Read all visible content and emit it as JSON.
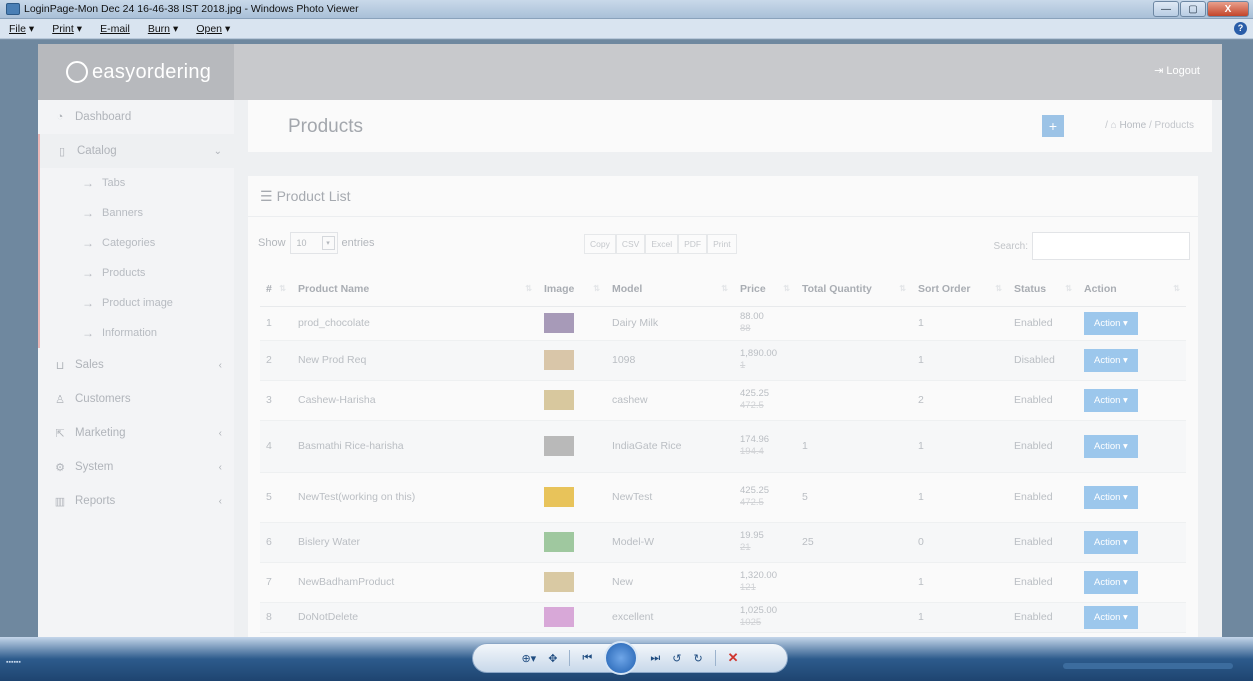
{
  "window": {
    "title": "LoginPage-Mon Dec 24 16-46-38 IST 2018.jpg - Windows Photo Viewer",
    "min": "—",
    "max": "▢",
    "close": "X"
  },
  "menu": {
    "items": [
      "File",
      "Print",
      "E-mail",
      "Burn",
      "Open"
    ],
    "help": "?"
  },
  "app": {
    "logo": "easyordering",
    "logout": "Logout",
    "sidebar": {
      "dashboard": "Dashboard",
      "catalog": "Catalog",
      "catalog_items": [
        "Tabs",
        "Banners",
        "Categories",
        "Products",
        "Product image",
        "Information"
      ],
      "sales": "Sales",
      "customers": "Customers",
      "marketing": "Marketing",
      "system": "System",
      "reports": "Reports"
    },
    "page_title": "Products",
    "breadcrumb": {
      "home": "Home",
      "sep": "/",
      "current": "Products"
    },
    "card_title": "Product List",
    "show_label": "Show",
    "entries_value": "10",
    "entries_label": "entries",
    "export_buttons": [
      "Copy",
      "CSV",
      "Excel",
      "PDF",
      "Print"
    ],
    "search_label": "Search:",
    "columns": [
      "#",
      "Product Name",
      "Image",
      "Model",
      "Price",
      "Total Quantity",
      "Sort Order",
      "Status",
      "Action"
    ],
    "rows": [
      {
        "n": "1",
        "name": "prod_chocolate",
        "model": "Dairy Milk",
        "price": "88.00",
        "price_old": "88",
        "qty": "",
        "sort": "1",
        "status": "Enabled",
        "action": "Action"
      },
      {
        "n": "2",
        "name": "New Prod Req",
        "model": "1098",
        "price": "1,890.00",
        "price_old": "1",
        "qty": "",
        "sort": "1",
        "status": "Disabled",
        "action": "Action"
      },
      {
        "n": "3",
        "name": "Cashew-Harisha",
        "model": "cashew",
        "price": "425.25",
        "price_old": "472.5",
        "qty": "",
        "sort": "2",
        "status": "Enabled",
        "action": "Action"
      },
      {
        "n": "4",
        "name": "Basmathi Rice-harisha",
        "model": "IndiaGate Rice",
        "price": "174.96",
        "price_old": "194.4",
        "qty": "1",
        "sort": "1",
        "status": "Enabled",
        "action": "Action"
      },
      {
        "n": "5",
        "name": "NewTest(working on this)",
        "model": "NewTest",
        "price": "425.25",
        "price_old": "472.5",
        "qty": "5",
        "sort": "1",
        "status": "Enabled",
        "action": "Action"
      },
      {
        "n": "6",
        "name": "Bislery Water",
        "model": "Model-W",
        "price": "19.95",
        "price_old": "21",
        "qty": "25",
        "sort": "0",
        "status": "Enabled",
        "action": "Action"
      },
      {
        "n": "7",
        "name": "NewBadhamProduct",
        "model": "New",
        "price": "1,320.00",
        "price_old": "121",
        "qty": "",
        "sort": "1",
        "status": "Enabled",
        "action": "Action"
      },
      {
        "n": "8",
        "name": "DoNotDelete",
        "model": "excellent",
        "price": "1,025.00",
        "price_old": "1025",
        "qty": "",
        "sort": "1",
        "status": "Enabled",
        "action": "Action"
      }
    ]
  },
  "thumb_colors": [
    "#a79ab8",
    "#d9c6a9",
    "#d8c89e",
    "#b9b9b9",
    "#e8c35a",
    "#9fc89f",
    "#d9c9a3",
    "#d8a8d8"
  ]
}
